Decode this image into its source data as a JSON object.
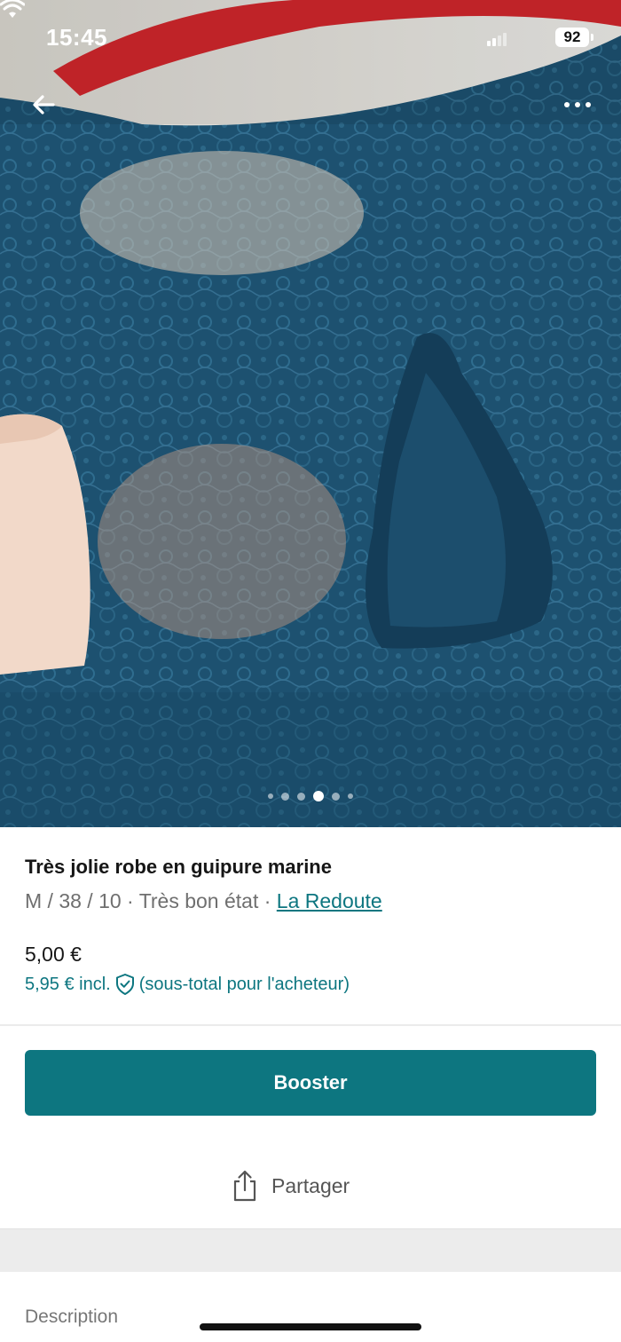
{
  "status_bar": {
    "time": "15:45",
    "battery": "92"
  },
  "header": {
    "back_icon": "arrow-left-icon",
    "more_icon": "ellipsis-icon"
  },
  "gallery": {
    "photo_count": 6,
    "active_index": 3
  },
  "item": {
    "title": "Très jolie robe en guipure marine",
    "meta_prefix": "M / 38 / 10 · Très bon état · ",
    "brand": "La Redoute",
    "price": "5,00 €",
    "buyer_price": "5,95 € incl.",
    "buyer_note": "(sous-total pour l'acheteur)"
  },
  "actions": {
    "booster_label": "Booster",
    "share_label": "Partager"
  },
  "sections": {
    "description_label": "Description"
  },
  "colors": {
    "accent": "#0d7680",
    "lace": "#1c4c67"
  }
}
